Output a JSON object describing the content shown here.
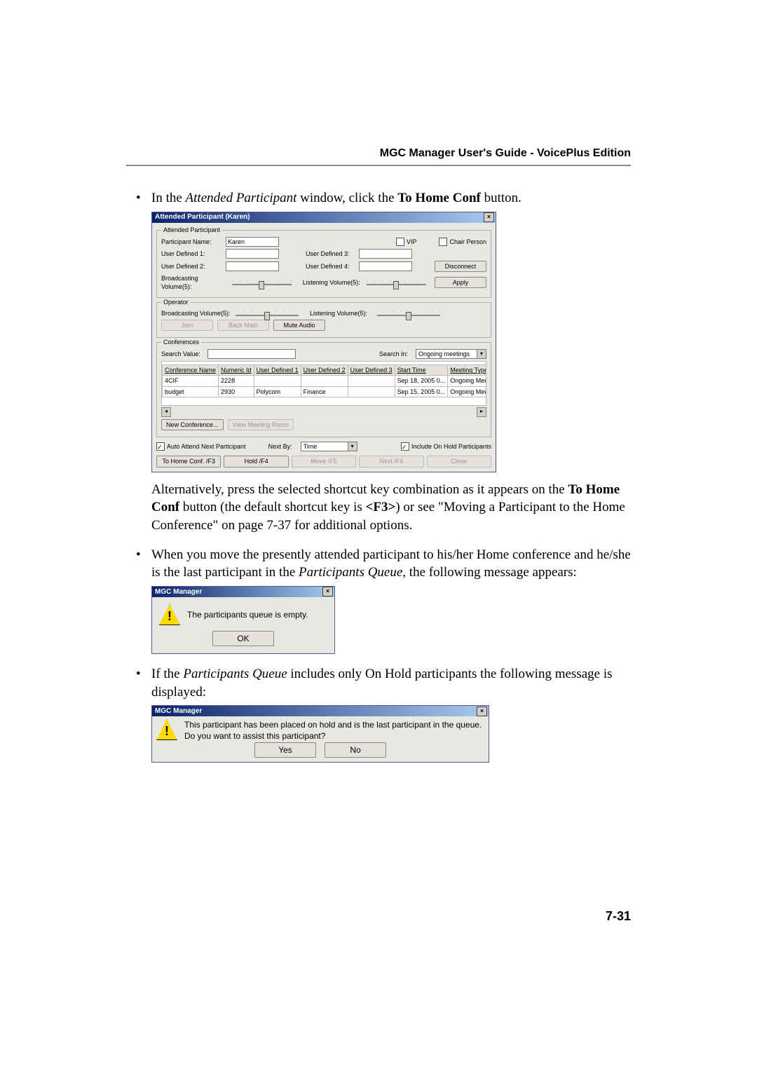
{
  "header": {
    "title": "MGC Manager User's Guide - VoicePlus Edition"
  },
  "page_number": "7-31",
  "bullets": {
    "b1_pre": "In the ",
    "b1_em": "Attended Participant",
    "b1_mid": " window, click the ",
    "b1_bold": "To Home Conf",
    "b1_post": " button.",
    "b1_after_pre": "Alternatively, press the selected shortcut key combination as it appears on the ",
    "b1_after_bold": "To Home Conf",
    "b1_after_mid": " button (the default shortcut key is ",
    "b1_after_key": "<F3>",
    "b1_after_post": ") or see \"Moving a Participant to the Home Conference\" on page 7-37 for additional options.",
    "b2_pre": "When you move the presently attended participant to his/her Home conference and he/she is the last participant in the ",
    "b2_em": "Participants Queue",
    "b2_post": ", the following message appears:",
    "b3_pre": "If the ",
    "b3_em": "Participants Queue",
    "b3_post": " includes only On Hold participants the following message is displayed:"
  },
  "attended_win": {
    "title": "Attended Participant (Karen)",
    "group_attended": "Attended Participant",
    "labels": {
      "participant_name": "Participant Name:",
      "vip": "VIP",
      "chair": "Chair Person",
      "ud1": "User Defined 1:",
      "ud2": "User Defined 2:",
      "ud3": "User Defined 3:",
      "ud4": "User Defined 4:",
      "broadcast5": "Broadcasting Volume(5):",
      "listen5": "Listening Volume(5):"
    },
    "participant_value": "Karen",
    "btn_disconnect": "Disconnect",
    "btn_apply": "Apply",
    "group_operator": "Operator",
    "op": {
      "broadcast5": "Broadcasting Volume(5):",
      "listen5": "Listening Volume(5):",
      "join": "Join",
      "back_main": "Back Main",
      "mute_audio": "Mute Audio"
    },
    "group_conferences": "Conferences",
    "search_value": "Search Value:",
    "search_in": "Search In:",
    "search_in_value": "Ongoing meetings",
    "columns": {
      "c1": "Conference Name",
      "c2": "Numeric Id",
      "c3": "User Defined 1",
      "c4": "User Defined 2",
      "c5": "User Defined 3",
      "c6": "Start Time",
      "c7": "Meeting Type"
    },
    "rows": [
      {
        "c1": "4CIF",
        "c2": "2228",
        "c3": "",
        "c4": "",
        "c5": "",
        "c6": "Sep 18, 2005  0...",
        "c7": "Ongoing Meeting"
      },
      {
        "c1": "budget",
        "c2": "2930",
        "c3": "Polycom",
        "c4": "Finance",
        "c5": "",
        "c6": "Sep 15, 2005  0...",
        "c7": "Ongoing Meeting"
      }
    ],
    "btn_new_conf": "New Conference...",
    "btn_view_mr": "View Meeting Room",
    "auto_attend": "Auto Attend Next Participant",
    "next_by": "Next By:",
    "next_by_value": "Time",
    "include_hold": "Include On Hold Participants",
    "bottom": {
      "to_home": "To Home Conf. /F3",
      "hold": "Hold /F4",
      "move": "Move /F5",
      "next": "Next /F6",
      "close": "Close"
    }
  },
  "msg1": {
    "title": "MGC Manager",
    "text": "The participants queue is empty.",
    "ok": "OK"
  },
  "msg2": {
    "title": "MGC Manager",
    "line1": "This participant has been placed on hold and is the last participant in the queue.",
    "line2": "Do you want to assist this participant?",
    "yes": "Yes",
    "no": "No"
  }
}
